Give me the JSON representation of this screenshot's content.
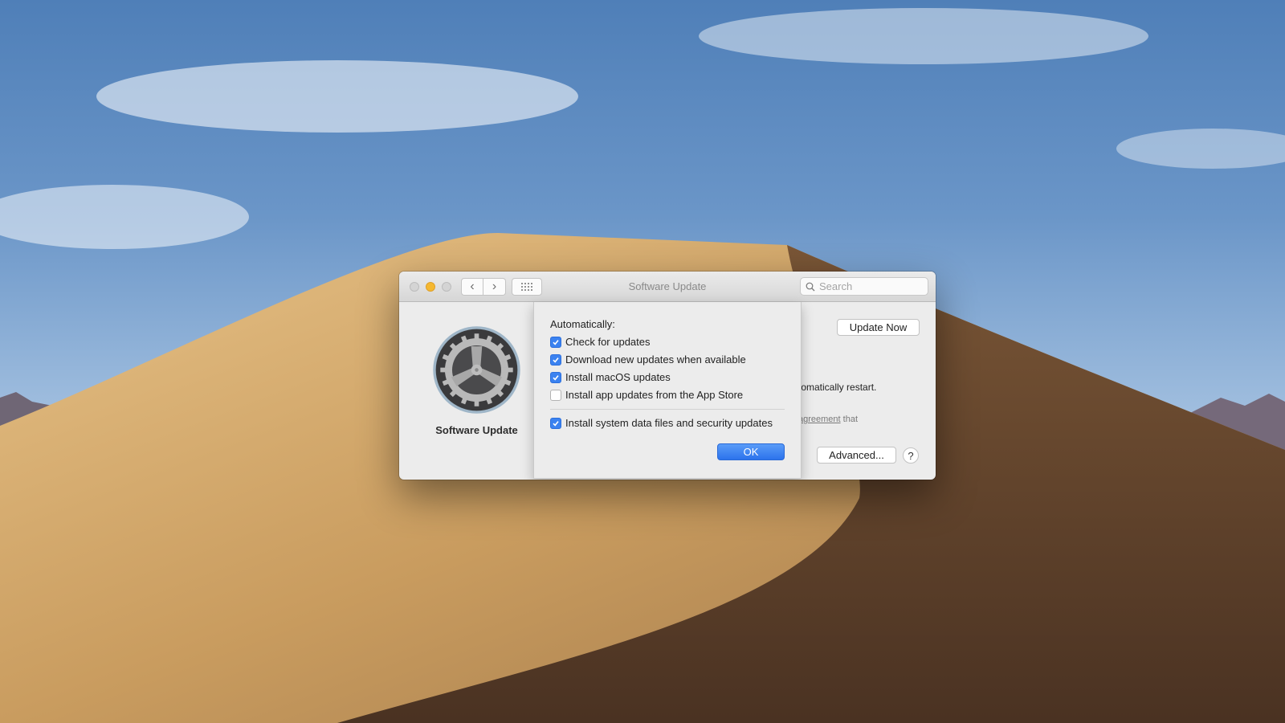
{
  "window": {
    "title": "Software Update",
    "search_placeholder": "Search",
    "pane_label": "Software Update",
    "update_now_label": "Update Now",
    "restart_text_partial": "tomatically restart.",
    "agreement_link_partial": " agreement",
    "agreement_suffix": " that",
    "advanced_label": "Advanced...",
    "help_label": "?"
  },
  "sheet": {
    "heading": "Automatically:",
    "options": [
      {
        "label": "Check for updates",
        "checked": true
      },
      {
        "label": "Download new updates when available",
        "checked": true
      },
      {
        "label": "Install macOS updates",
        "checked": true
      },
      {
        "label": "Install app updates from the App Store",
        "checked": false
      }
    ],
    "security_option": {
      "label": "Install system data files and security updates",
      "checked": true
    },
    "ok_label": "OK"
  },
  "colors": {
    "accent": "#3b82f0",
    "minimize": "#f5b830"
  }
}
